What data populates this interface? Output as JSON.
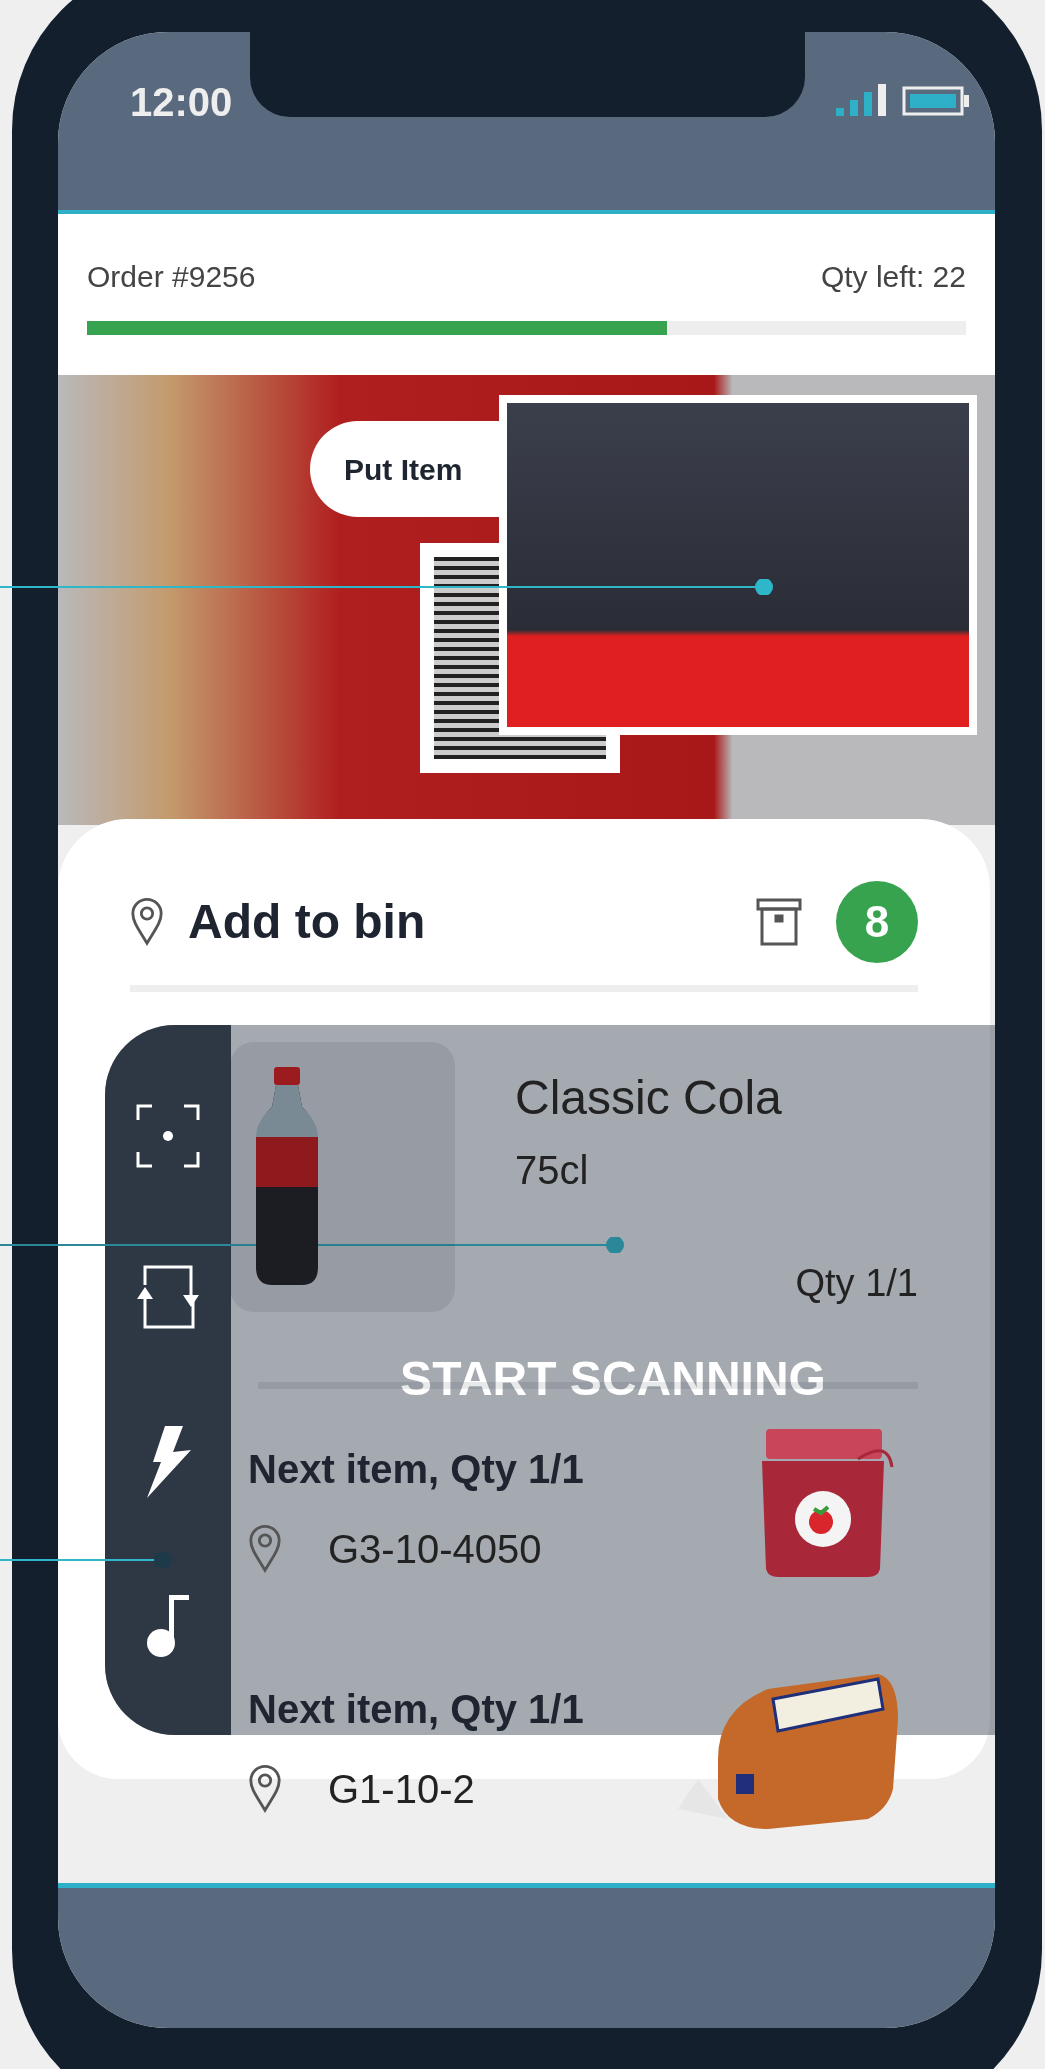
{
  "status_bar": {
    "time": "12:00"
  },
  "order": {
    "title": "Order #9256",
    "qty_left": "Qty left: 22",
    "level": 0.66
  },
  "put_item_label": "Put Item",
  "bin": {
    "title": "Add to bin",
    "count": "8"
  },
  "current_item": {
    "name": "Classic Cola",
    "size": "75cl",
    "qty": "Qty 1/1"
  },
  "next_items": [
    {
      "title": "Next item, Qty 1/1",
      "location": "G3-10-4050",
      "kind": "jam"
    },
    {
      "title": "Next item, Qty 1/1",
      "location": "G1-10-2",
      "kind": "bread"
    }
  ],
  "scanner": {
    "label": "START SCANNING"
  }
}
